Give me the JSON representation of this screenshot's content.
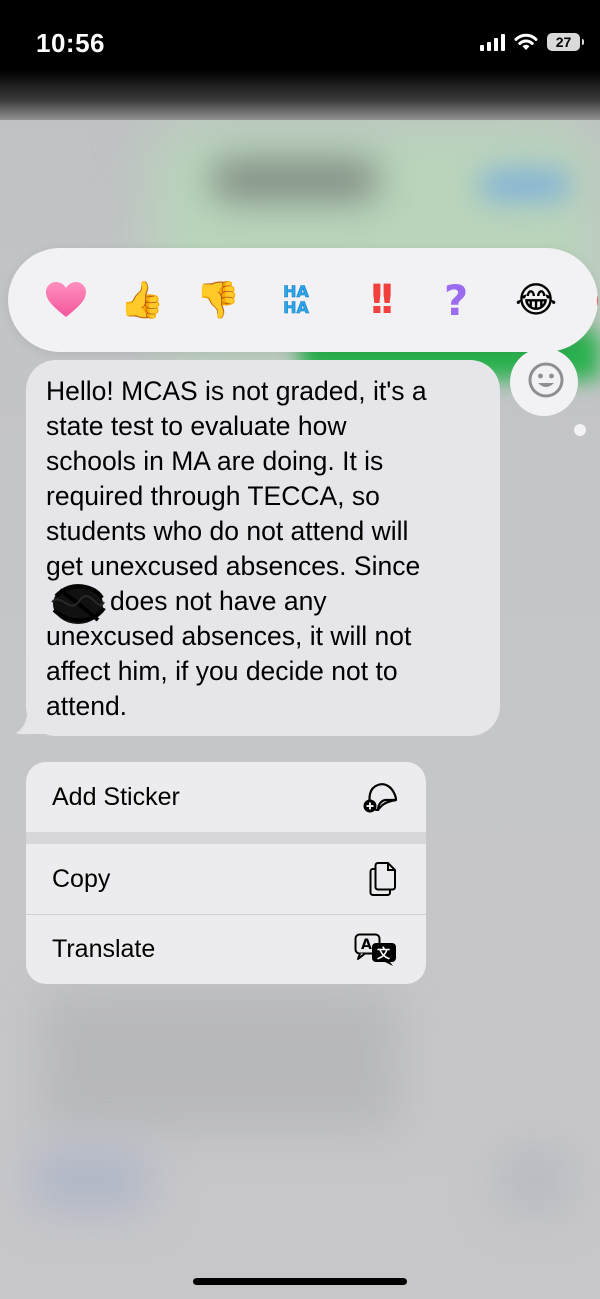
{
  "status_bar": {
    "time": "10:56",
    "battery": "27",
    "icons": [
      "cellular-signal-icon",
      "wifi-icon",
      "battery-icon"
    ]
  },
  "reactions": {
    "items": [
      {
        "name": "heart",
        "glyph": "❤"
      },
      {
        "name": "thumbs-up",
        "glyph": "👍"
      },
      {
        "name": "thumbs-down",
        "glyph": "👎"
      },
      {
        "name": "haha",
        "text": "HA HA"
      },
      {
        "name": "emphasize",
        "glyph": "‼"
      },
      {
        "name": "question",
        "glyph": "?"
      },
      {
        "name": "laugh-cry",
        "glyph": "😂"
      }
    ],
    "add_emoji_icon": "smiley-icon"
  },
  "message": {
    "lines": [
      "Hello! MCAS is not graded, it's a",
      "state test to evaluate how",
      "schools in MA are doing. It is",
      "required through TECCA, so",
      "students who do not attend will",
      "get unexcused absences. Since",
      "does not have any",
      "unexcused absences, it will not",
      "affect him, if you decide not to",
      "attend."
    ]
  },
  "context_menu": {
    "add_sticker": "Add Sticker",
    "copy": "Copy",
    "translate": "Translate"
  },
  "colors": {
    "bubble": "#e6e6ea",
    "menu": "#ececee",
    "reaction_bar": "#f2f2f4"
  }
}
